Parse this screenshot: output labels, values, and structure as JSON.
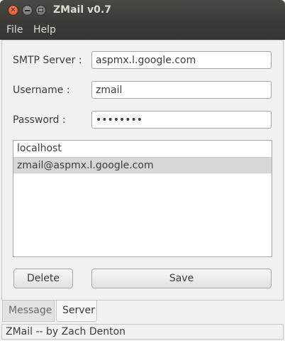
{
  "window": {
    "title": "ZMail v0.7"
  },
  "menu": {
    "file": "File",
    "help": "Help"
  },
  "form": {
    "smtp_label": "SMTP Server :",
    "smtp_value": "aspmx.l.google.com",
    "username_label": "Username :",
    "username_value": "zmail",
    "password_label": "Password :",
    "password_value": "••••••••"
  },
  "accounts": {
    "items": [
      {
        "label": "localhost",
        "selected": false
      },
      {
        "label": "zmail@aspmx.l.google.com",
        "selected": true
      }
    ]
  },
  "buttons": {
    "delete": "Delete",
    "save": "Save"
  },
  "tabs": {
    "message": "Message",
    "server": "Server",
    "active": "Server"
  },
  "status": {
    "text": "ZMail -- by Zach Denton"
  },
  "colors": {
    "titlebar": "#3c3b37",
    "close_button": "#df4a14",
    "selection": "#d9d7d3"
  }
}
